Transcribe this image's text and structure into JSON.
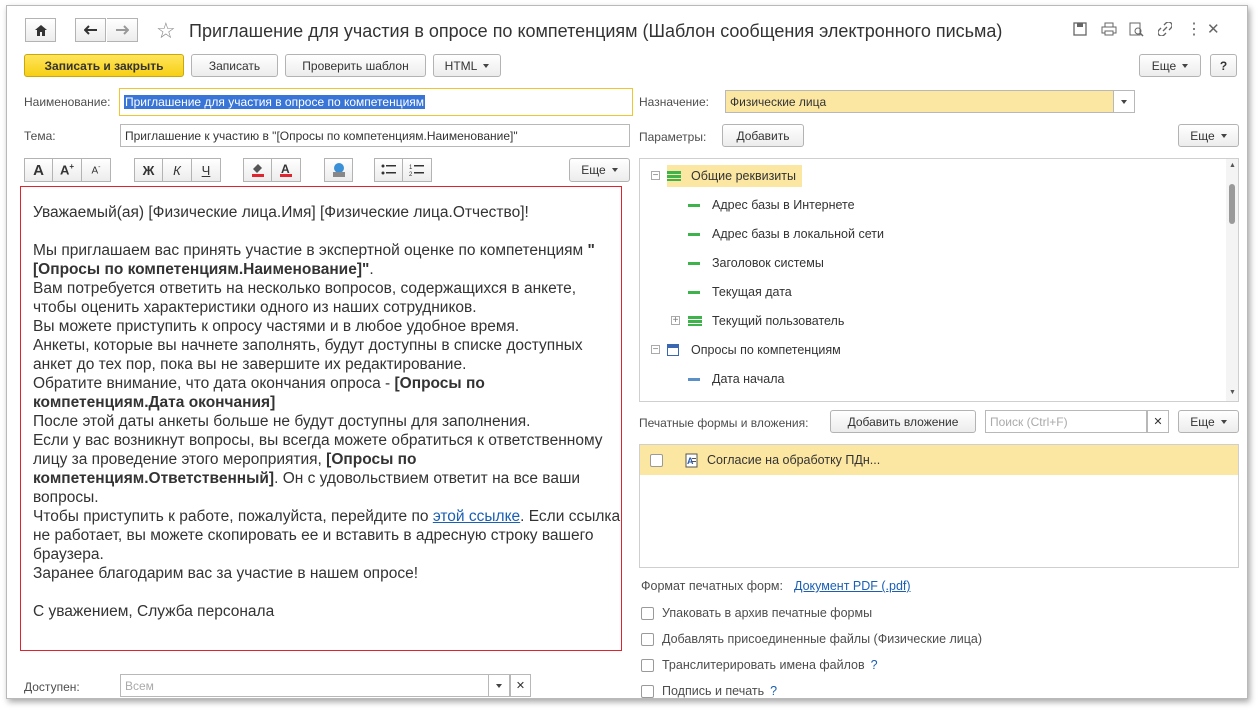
{
  "window": {
    "title": "Приглашение для участия в опросе по компетенциям (Шаблон сообщения электронного письма)"
  },
  "toolbar": {
    "save_close": "Записать и закрыть",
    "save": "Записать",
    "check_template": "Проверить шаблон",
    "html": "HTML",
    "more": "Еще",
    "help": "?"
  },
  "form": {
    "name_label": "Наименование:",
    "name_value": "Приглашение для участия в опросе по компетенциям",
    "subject_label": "Тема:",
    "subject_value": "Приглашение к участию в \"[Опросы по компетенциям.Наименование]\"",
    "purpose_label": "Назначение:",
    "purpose_value": "Физические лица",
    "params_label": "Параметры:",
    "add_button": "Добавить",
    "more": "Еще",
    "access_label": "Доступен:",
    "access_placeholder": "Всем"
  },
  "format_toolbar": {
    "bold": "Ж",
    "italic": "К",
    "underline": "Ч",
    "more": "Еще"
  },
  "editor": {
    "greeting": "Уважаемый(ая) [Физические лица.Имя] [Физические лица.Отчество]!",
    "p1_a": "Мы приглашаем вас принять участие в экспертной оценке по компетенциям ",
    "p1_b": "\"[Опросы по компетенциям.Наименование]\"",
    "p1_c": ".",
    "p2": "Вам потребуется ответить на несколько вопросов, содержащихся в анкете, чтобы оценить характеристики одного из наших сотрудников.",
    "p3": "Вы можете приступить к опросу частями и в любое удобное время.",
    "p4": "Анкеты, которые вы начнете заполнять, будут доступны в списке доступных анкет до тех пор, пока вы не завершите их редактирование.",
    "p5_a": "Обратите внимание, что дата окончания опроса - ",
    "p5_b": "[Опросы по компетенциям.Дата окончания]",
    "p6": "После этой даты анкеты больше не будут доступны для заполнения.",
    "p7_a": "Если у вас возникнут вопросы, вы всегда можете обратиться к ответственному лицу за проведение этого мероприятия, ",
    "p7_b": "[Опросы по компетенциям.Ответственный]",
    "p7_c": ". Он с удовольствием ответит на все ваши вопросы.",
    "p8_a": "Чтобы приступить к работе, пожалуйста, перейдите по ",
    "p8_link": "этой ссылке",
    "p8_b": ". Если ссылка не работает, вы можете скопировать ее и вставить в адресную строку вашего браузера.",
    "p9": "Заранее благодарим вас за участие в нашем опросе!",
    "sign": "С уважением, Служба персонала"
  },
  "tree": {
    "items": [
      {
        "label": "Общие реквизиты"
      },
      {
        "label": "Адрес базы в Интернете"
      },
      {
        "label": "Адрес базы в локальной сети"
      },
      {
        "label": "Заголовок системы"
      },
      {
        "label": "Текущая дата"
      },
      {
        "label": "Текущий пользователь"
      },
      {
        "label": "Опросы по компетенциям"
      },
      {
        "label": "Дата начала"
      }
    ]
  },
  "attachments": {
    "label": "Печатные формы и вложения:",
    "add_button": "Добавить вложение",
    "search_placeholder": "Поиск (Ctrl+F)",
    "more": "Еще",
    "items": [
      {
        "label": "Согласие на обработку ПДн..."
      }
    ]
  },
  "options": {
    "format_label": "Формат печатных форм:",
    "format_value": "Документ PDF (.pdf)",
    "pack_archive": "Упаковать в архив печатные формы",
    "add_attached": "Добавлять присоединенные файлы (Физические лица)",
    "transliterate": "Транслитерировать имена файлов",
    "sign_stamp": "Подпись и печать",
    "help": "?"
  },
  "colors": {
    "accent_yellow": "#f7cf14",
    "selection_blue": "#3875d7",
    "editor_border": "#e0242f",
    "highlight_row": "#fbe6a2",
    "link": "#1a5fb4"
  }
}
